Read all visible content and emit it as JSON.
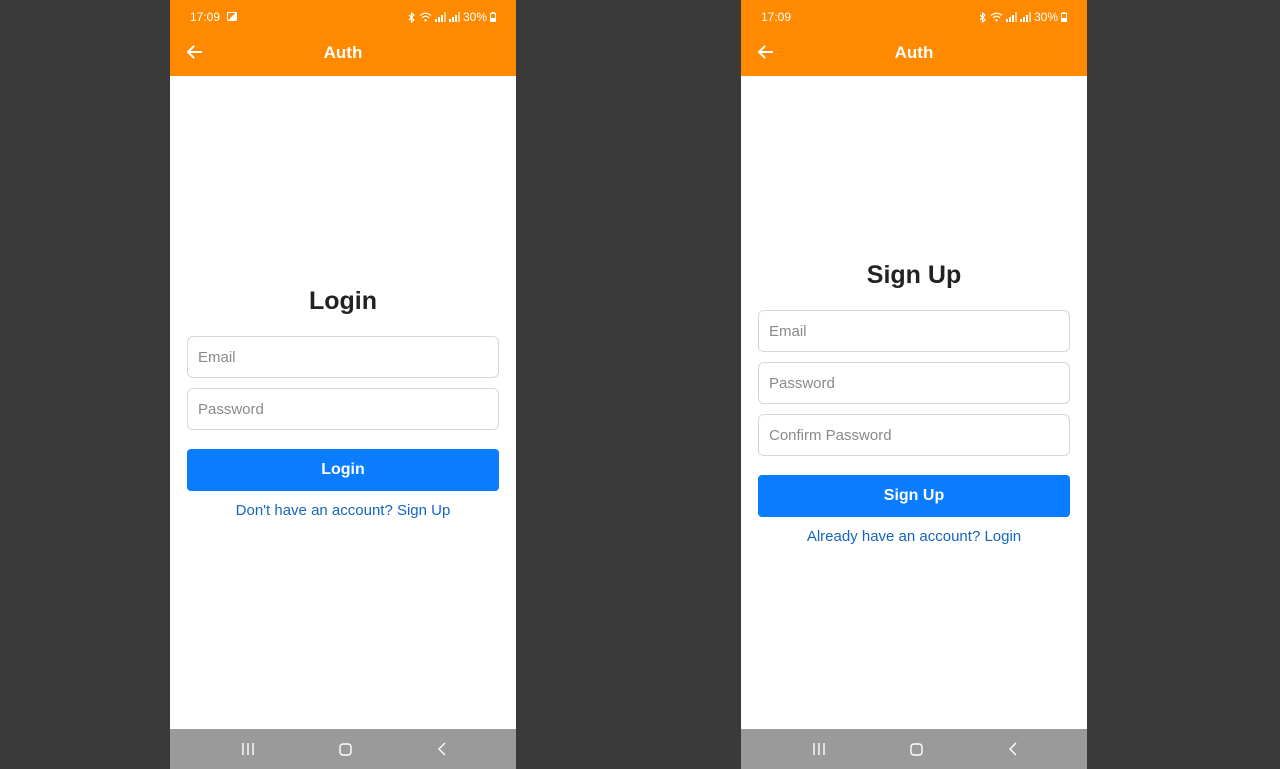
{
  "status_bar": {
    "time": "17:09",
    "battery": "30%"
  },
  "appbar": {
    "title": "Auth",
    "back_icon": "arrow-left-icon"
  },
  "login_screen": {
    "title": "Login",
    "email_placeholder": "Email",
    "password_placeholder": "Password",
    "button_label": "Login",
    "switch_link": "Don't have an account? Sign Up"
  },
  "signup_screen": {
    "title": "Sign Up",
    "email_placeholder": "Email",
    "password_placeholder": "Password",
    "confirm_password_placeholder": "Confirm Password",
    "button_label": "Sign Up",
    "switch_link": "Already have an account? Login"
  },
  "colors": {
    "appbar": "#ff8a00",
    "primary_button": "#0a7cff",
    "link": "#1565c0",
    "nav_bar": "#9a9a9a",
    "backdrop": "#3a3a3a"
  },
  "nav_bar": {
    "icons": [
      "recent-apps-icon",
      "home-icon",
      "back-icon"
    ]
  }
}
